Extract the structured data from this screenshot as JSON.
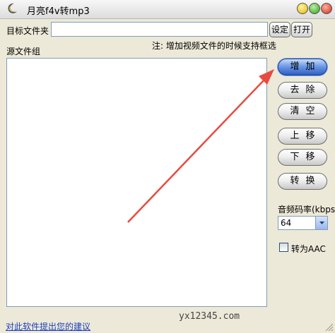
{
  "window": {
    "title": "月亮f4v转mp3"
  },
  "target_folder": {
    "label": "目标文件夹",
    "value": "",
    "set_label": "设定",
    "open_label": "打开"
  },
  "hint": "注: 增加视频文件的时候支持框选",
  "source_group": {
    "label": "源文件组"
  },
  "buttons": {
    "add": "增加",
    "remove": "去除",
    "clear": "清空",
    "move_up": "上移",
    "move_down": "下移",
    "convert": "转换"
  },
  "bitrate": {
    "label": "音频码率(kbps)",
    "selected": "64"
  },
  "aac": {
    "label": "转为AAC",
    "checked": false
  },
  "watermark": "yx12345.com",
  "feedback_link": "对此软件提出您的建议",
  "colors": {
    "accent": "#2f5fc4",
    "arrow": "#e84a40"
  }
}
